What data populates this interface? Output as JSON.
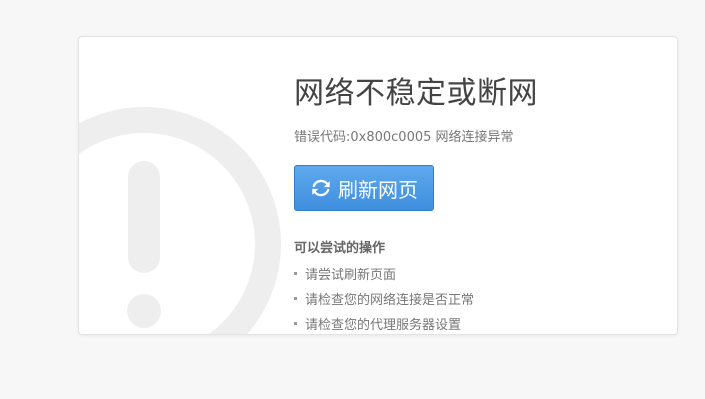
{
  "error": {
    "title": "网络不稳定或断网",
    "code_text": "错误代码:0x800c0005 网络连接异常"
  },
  "actions": {
    "refresh_label": "刷新网页"
  },
  "suggestions": {
    "title": "可以尝试的操作",
    "items": [
      "请尝试刷新页面",
      "请检查您的网络连接是否正常",
      "请检查您的代理服务器设置"
    ]
  },
  "icons": {
    "background": "warning-exclamation-icon",
    "refresh": "refresh-icon"
  },
  "colors": {
    "accent": "#4c9ae6",
    "background": "#f7f7f7",
    "card": "#ffffff",
    "title_text": "#444444"
  }
}
